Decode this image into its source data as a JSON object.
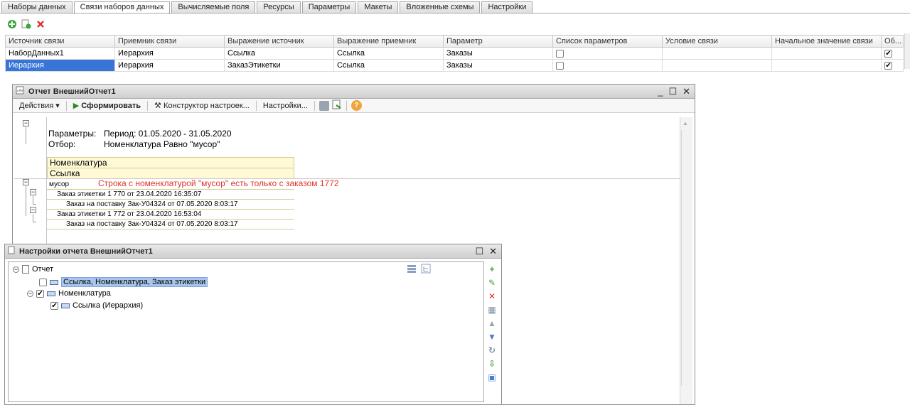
{
  "tabs": [
    {
      "label": "Наборы данных"
    },
    {
      "label": "Связи наборов данных"
    },
    {
      "label": "Вычисляемые поля"
    },
    {
      "label": "Ресурсы"
    },
    {
      "label": "Параметры"
    },
    {
      "label": "Макеты"
    },
    {
      "label": "Вложенные схемы"
    },
    {
      "label": "Настройки"
    }
  ],
  "active_tab": "Связи наборов данных",
  "links_table": {
    "columns": [
      "Источник связи",
      "Приемник связи",
      "Выражение источник",
      "Выражение приемник",
      "Параметр",
      "Список параметров",
      "Условие связи",
      "Начальное значение связи",
      "Об..."
    ],
    "rows": [
      {
        "source": "НаборДанных1",
        "target": "Иерархия",
        "source_expr": "Ссылка",
        "target_expr": "Ссылка",
        "param": "Заказы",
        "param_list": false,
        "condition": "",
        "initial": "",
        "required": true
      },
      {
        "source": "Иерархия",
        "target": "Иерархия",
        "source_expr": "ЗаказЭтикетки",
        "target_expr": "Ссылка",
        "param": "Заказы",
        "param_list": false,
        "condition": "",
        "initial": "",
        "required": true
      }
    ]
  },
  "report_window": {
    "title": "Отчет  ВнешнийОтчет1",
    "toolbar": {
      "actions": "Действия",
      "generate": "Сформировать",
      "constructor": "Конструктор настроек...",
      "settings": "Настройки..."
    },
    "params_label": "Параметры:",
    "params_value": "Период: 01.05.2020 - 31.05.2020",
    "filter_label": "Отбор:",
    "filter_value": "Номенклатура Равно \"мусор\"",
    "header1": "Номенклатура",
    "header2": "Ссылка",
    "group_value": "мусор",
    "annotation": "Строка с номенклатурой \"мусор\" есть только с заказом 1772",
    "annotation_color": "#e0312b",
    "rows": [
      {
        "level": 1,
        "text": "Заказ этикетки 1 770 от 23.04.2020 16:35:07"
      },
      {
        "level": 2,
        "text": "Заказ на поставку Зак-У04324 от 07.05.2020 8:03:17"
      },
      {
        "level": 1,
        "text": "Заказ этикетки 1 772 от 23.04.2020 16:53:04"
      },
      {
        "level": 2,
        "text": "Заказ на поставку Зак-У04324 от 07.05.2020 8:03:17"
      }
    ]
  },
  "settings_window": {
    "title": "Настройки отчета  ВнешнийОтчет1",
    "tree": {
      "root": "Отчет",
      "item1": "Ссылка, Номенклатура, Заказ этикетки",
      "item1_checked": false,
      "item2": "Номенклатура",
      "item2_checked": true,
      "item3": "Ссылка (Иерархия)",
      "item3_checked": true
    }
  },
  "accent_color": "#3875d7"
}
